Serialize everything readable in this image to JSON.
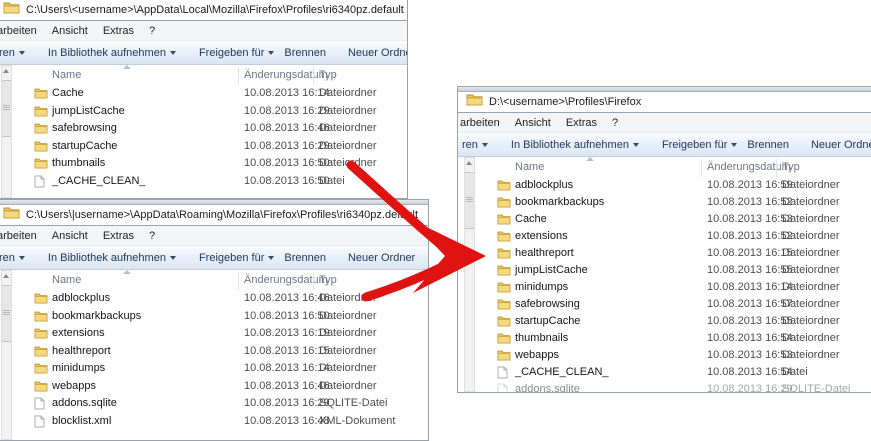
{
  "chrome": {
    "menu": [
      "arbeiten",
      "Ansicht",
      "Extras",
      "?"
    ],
    "toolbar": [
      {
        "label": "ren",
        "caret": true
      },
      {
        "label": "In Bibliothek aufnehmen",
        "caret": true
      },
      {
        "label": "Freigeben für",
        "caret": true
      },
      {
        "label": "Brennen",
        "caret": false
      },
      {
        "label": "Neuer Ordner",
        "caret": false
      }
    ],
    "columns": [
      "Name",
      "Änderungsdatum",
      "Typ"
    ]
  },
  "windows": [
    {
      "path": "C:\\Users\\<username>\\AppData\\Local\\Mozilla\\Firefox\\Profiles\\ri6340pz.default",
      "band": false,
      "rows": [
        {
          "name": "Cache",
          "date": "10.08.2013 16:14",
          "type": "Dateiordner",
          "icon": "folder"
        },
        {
          "name": "jumpListCache",
          "date": "10.08.2013 16:29",
          "type": "Dateiordner",
          "icon": "folder"
        },
        {
          "name": "safebrowsing",
          "date": "10.08.2013 16:46",
          "type": "Dateiordner",
          "icon": "folder"
        },
        {
          "name": "startupCache",
          "date": "10.08.2013 16:29",
          "type": "Dateiordner",
          "icon": "folder"
        },
        {
          "name": "thumbnails",
          "date": "10.08.2013 16:50",
          "type": "Dateiordner",
          "icon": "folder"
        },
        {
          "name": "_CACHE_CLEAN_",
          "date": "10.08.2013 16:50",
          "type": "Datei",
          "icon": "file"
        }
      ]
    },
    {
      "path": "C:\\Users\\|username>\\AppData\\Roaming\\Mozilla\\Firefox\\Profiles\\ri6340pz.default",
      "band": true,
      "rows": [
        {
          "name": "adblockplus",
          "date": "10.08.2013 16:46",
          "type": "Dateiordner",
          "icon": "folder"
        },
        {
          "name": "bookmarkbackups",
          "date": "10.08.2013 16:50",
          "type": "Dateiordner",
          "icon": "folder"
        },
        {
          "name": "extensions",
          "date": "10.08.2013 16:19",
          "type": "Dateiordner",
          "icon": "folder"
        },
        {
          "name": "healthreport",
          "date": "10.08.2013 16:15",
          "type": "Dateiordner",
          "icon": "folder"
        },
        {
          "name": "minidumps",
          "date": "10.08.2013 16:14",
          "type": "Dateiordner",
          "icon": "folder"
        },
        {
          "name": "webapps",
          "date": "10.08.2013 16:46",
          "type": "Dateiordner",
          "icon": "folder"
        },
        {
          "name": "addons.sqlite",
          "date": "10.08.2013 16:29",
          "type": "SQLITE-Datei",
          "icon": "file"
        },
        {
          "name": "blocklist.xml",
          "date": "10.08.2013 16:48",
          "type": "XML-Dokument",
          "icon": "file"
        }
      ]
    },
    {
      "path": "D:\\<username>\\Profiles\\Firefox",
      "band": true,
      "rows": [
        {
          "name": "adblockplus",
          "date": "10.08.2013 16:59",
          "type": "Dateiordner",
          "icon": "folder"
        },
        {
          "name": "bookmarkbackups",
          "date": "10.08.2013 16:52",
          "type": "Dateiordner",
          "icon": "folder"
        },
        {
          "name": "Cache",
          "date": "10.08.2013 16:53",
          "type": "Dateiordner",
          "icon": "folder"
        },
        {
          "name": "extensions",
          "date": "10.08.2013 16:52",
          "type": "Dateiordner",
          "icon": "folder"
        },
        {
          "name": "healthreport",
          "date": "10.08.2013 16:15",
          "type": "Dateiordner",
          "icon": "folder"
        },
        {
          "name": "jumpListCache",
          "date": "10.08.2013 16:55",
          "type": "Dateiordner",
          "icon": "folder"
        },
        {
          "name": "minidumps",
          "date": "10.08.2013 16:14",
          "type": "Dateiordner",
          "icon": "folder"
        },
        {
          "name": "safebrowsing",
          "date": "10.08.2013 16:57",
          "type": "Dateiordner",
          "icon": "folder"
        },
        {
          "name": "startupCache",
          "date": "10.08.2013 16:55",
          "type": "Dateiordner",
          "icon": "folder"
        },
        {
          "name": "thumbnails",
          "date": "10.08.2013 16:54",
          "type": "Dateiordner",
          "icon": "folder"
        },
        {
          "name": "webapps",
          "date": "10.08.2013 16:53",
          "type": "Dateiordner",
          "icon": "folder"
        },
        {
          "name": "_CACHE_CLEAN_",
          "date": "10.08.2013 16:54",
          "type": "Datei",
          "icon": "file"
        },
        {
          "name": "addons.sqlite",
          "date": "10.08.2013 16:29",
          "type": "SQLITE-Datei",
          "icon": "file",
          "clipped": true
        }
      ]
    }
  ],
  "arrow": {
    "color": "#e11212",
    "meaning": "merge-into"
  }
}
